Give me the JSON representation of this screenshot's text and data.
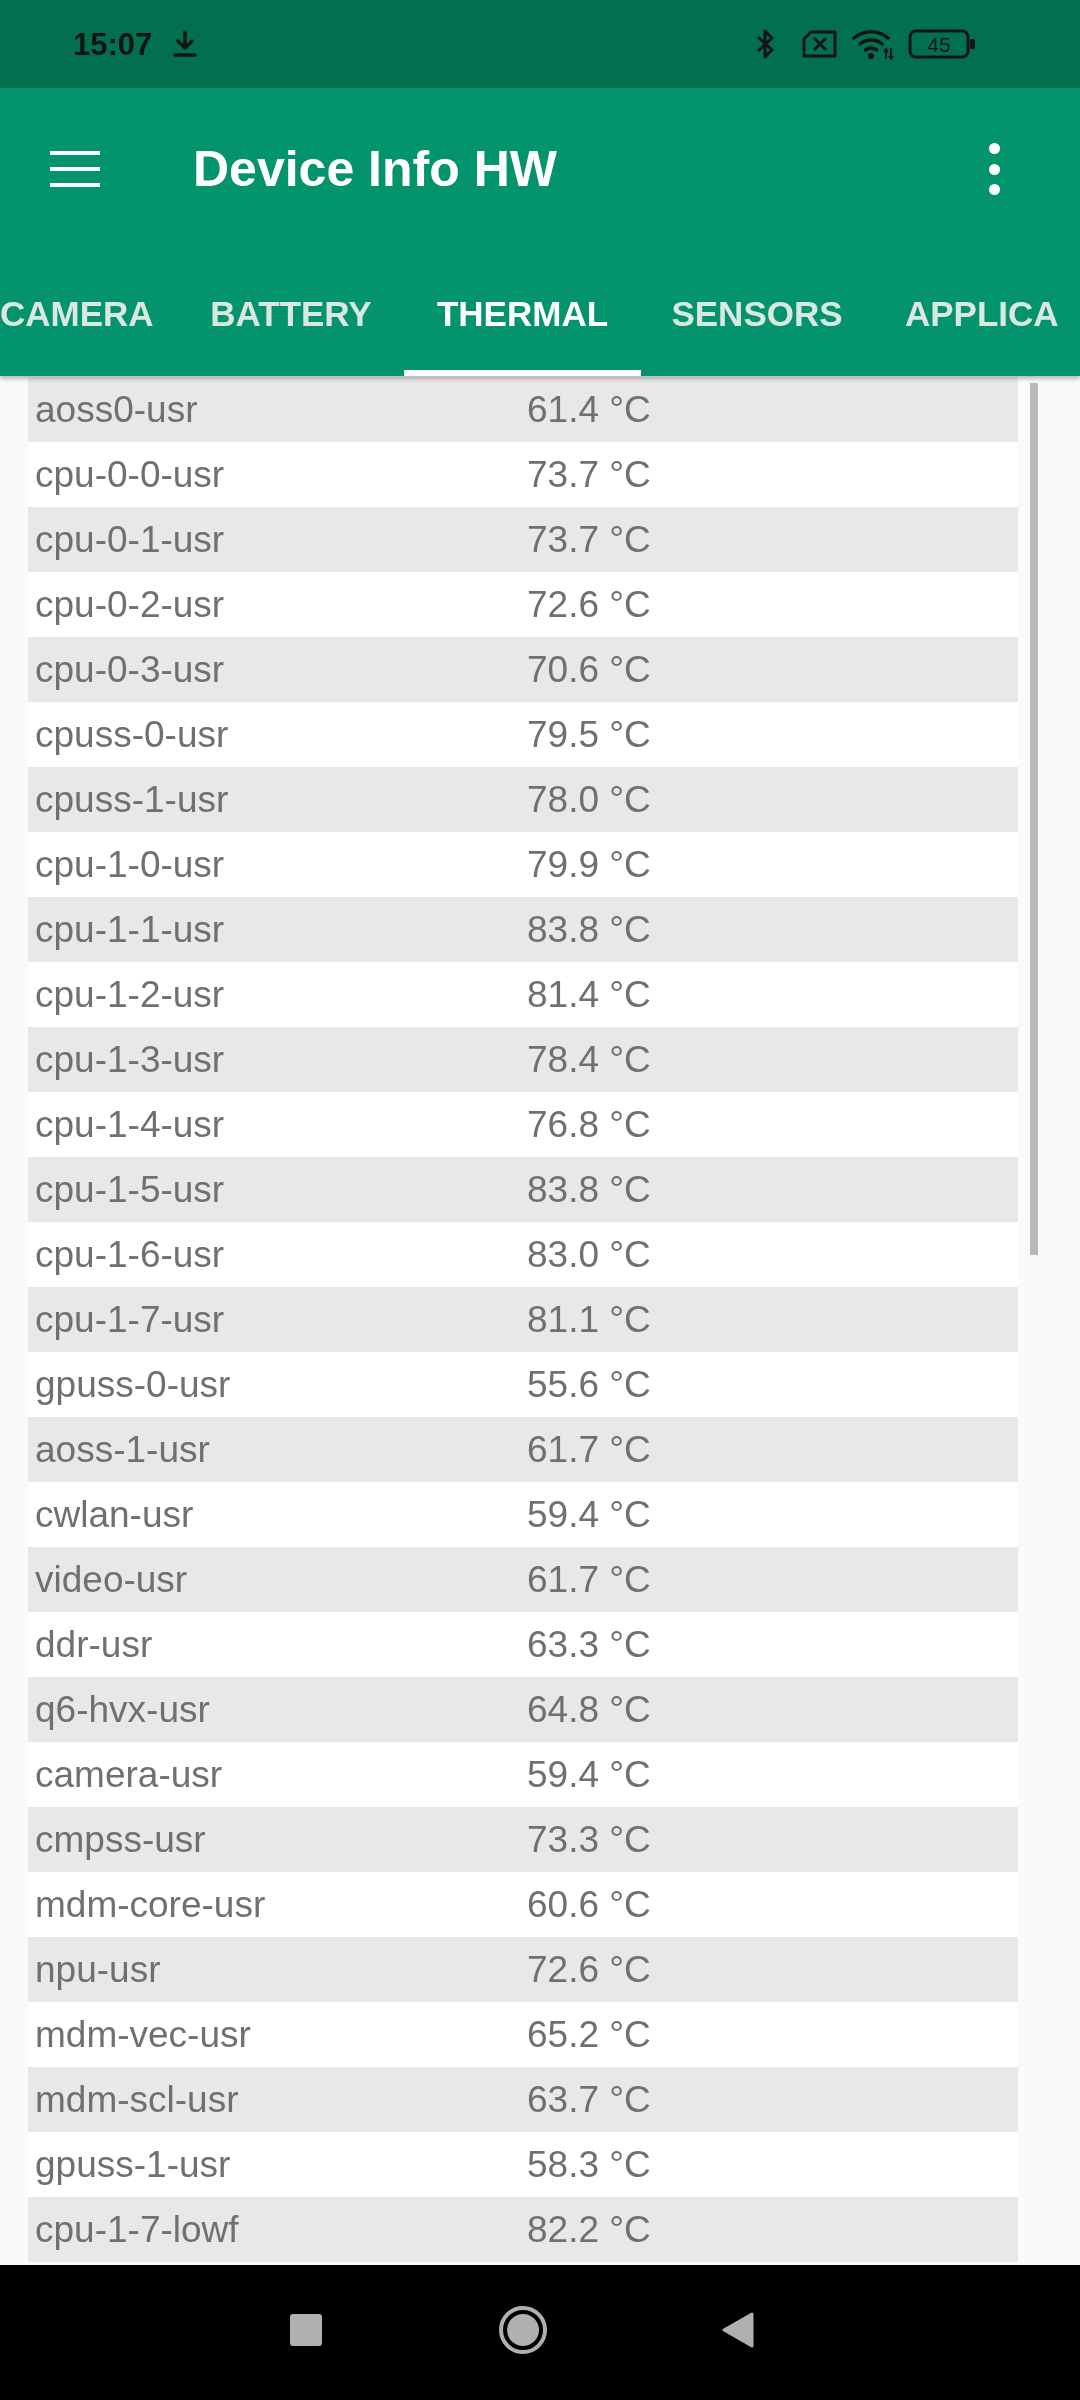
{
  "status_bar": {
    "time": "15:07",
    "battery": "45"
  },
  "app_bar": {
    "title": "Device Info HW"
  },
  "tabs": [
    {
      "label": "CAMERA",
      "selected": false
    },
    {
      "label": "BATTERY",
      "selected": false
    },
    {
      "label": "THERMAL",
      "selected": true
    },
    {
      "label": "SENSORS",
      "selected": false
    },
    {
      "label": "APPLICA",
      "selected": false
    }
  ],
  "thermal_zones": [
    {
      "name": "aoss0-usr",
      "temperature": "61.4 °C"
    },
    {
      "name": "cpu-0-0-usr",
      "temperature": "73.7 °C"
    },
    {
      "name": "cpu-0-1-usr",
      "temperature": "73.7 °C"
    },
    {
      "name": "cpu-0-2-usr",
      "temperature": "72.6 °C"
    },
    {
      "name": "cpu-0-3-usr",
      "temperature": "70.6 °C"
    },
    {
      "name": "cpuss-0-usr",
      "temperature": "79.5 °C"
    },
    {
      "name": "cpuss-1-usr",
      "temperature": "78.0 °C"
    },
    {
      "name": "cpu-1-0-usr",
      "temperature": "79.9 °C"
    },
    {
      "name": "cpu-1-1-usr",
      "temperature": "83.8 °C"
    },
    {
      "name": "cpu-1-2-usr",
      "temperature": "81.4 °C"
    },
    {
      "name": "cpu-1-3-usr",
      "temperature": "78.4 °C"
    },
    {
      "name": "cpu-1-4-usr",
      "temperature": "76.8 °C"
    },
    {
      "name": "cpu-1-5-usr",
      "temperature": "83.8 °C"
    },
    {
      "name": "cpu-1-6-usr",
      "temperature": "83.0 °C"
    },
    {
      "name": "cpu-1-7-usr",
      "temperature": "81.1 °C"
    },
    {
      "name": "gpuss-0-usr",
      "temperature": "55.6 °C"
    },
    {
      "name": "aoss-1-usr",
      "temperature": "61.7 °C"
    },
    {
      "name": "cwlan-usr",
      "temperature": "59.4 °C"
    },
    {
      "name": "video-usr",
      "temperature": "61.7 °C"
    },
    {
      "name": "ddr-usr",
      "temperature": "63.3 °C"
    },
    {
      "name": "q6-hvx-usr",
      "temperature": "64.8 °C"
    },
    {
      "name": "camera-usr",
      "temperature": "59.4 °C"
    },
    {
      "name": "cmpss-usr",
      "temperature": "73.3 °C"
    },
    {
      "name": "mdm-core-usr",
      "temperature": "60.6 °C"
    },
    {
      "name": "npu-usr",
      "temperature": "72.6 °C"
    },
    {
      "name": "mdm-vec-usr",
      "temperature": "65.2 °C"
    },
    {
      "name": "mdm-scl-usr",
      "temperature": "63.7 °C"
    },
    {
      "name": "gpuss-1-usr",
      "temperature": "58.3 °C"
    },
    {
      "name": "cpu-1-7-lowf",
      "temperature": "82.2 °C"
    }
  ]
}
